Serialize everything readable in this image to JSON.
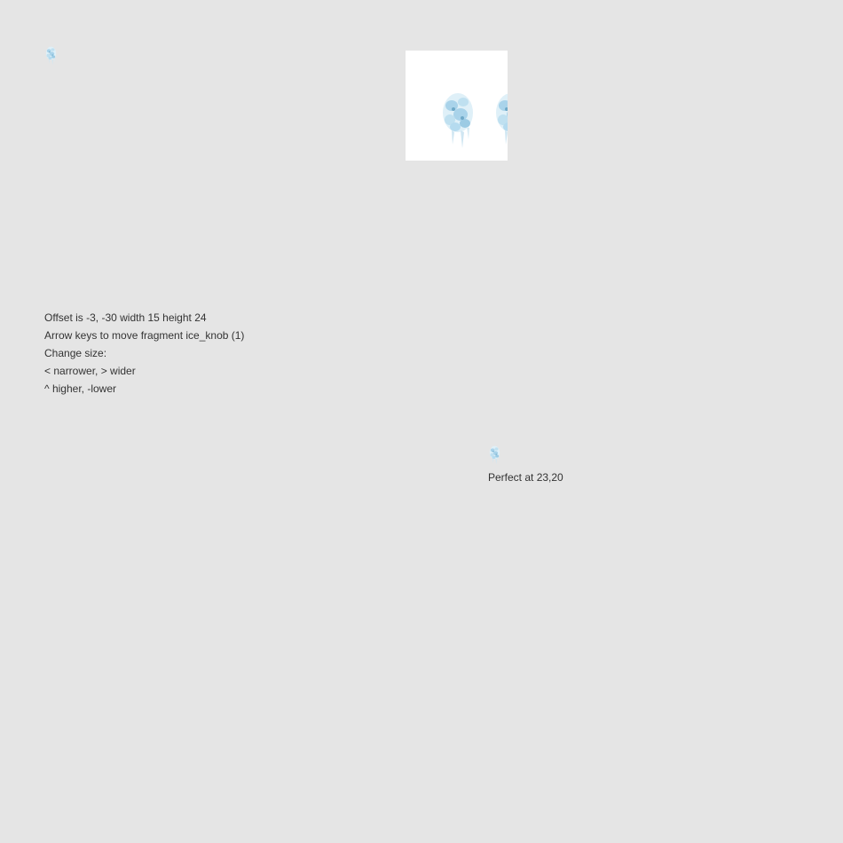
{
  "fragment": {
    "name": "ice_knob (1)",
    "icon": "ice-knob-sprite"
  },
  "info": {
    "offset_text": "Offset is -3, -30 width 15 height 24",
    "arrow_text": "Arrow keys to move fragment ice_knob (1)",
    "change_size_text": "Change size:",
    "width_keys_text": "< narrower, > wider",
    "height_keys_text": "^ higher, -lower"
  },
  "result": {
    "status_text": "Perfect at 23,20"
  },
  "colors": {
    "background": "#e5e5e5",
    "sheet_background": "#ffffff",
    "text": "#333333",
    "ice_light": "#dff0f8",
    "ice_mid": "#a9d3ea",
    "ice_dark": "#6fa9c8"
  }
}
